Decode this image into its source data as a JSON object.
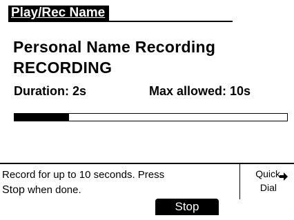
{
  "header": {
    "title": "Play/Rec Name"
  },
  "main": {
    "heading_line1": "Personal Name Recording",
    "heading_line2": "RECORDING",
    "duration": "Duration: 2s",
    "max_allowed": "Max allowed: 10s",
    "progress_fraction": 0.2
  },
  "footer": {
    "message_line1": "Record for up to 10 seconds. Press",
    "message_stop": "Stop",
    "message_rest": " when done.",
    "quick_line1": "Quick",
    "quick_line2": "Dial",
    "quick_icon": "arrow-right-icon",
    "softkey_label": "Stop"
  }
}
